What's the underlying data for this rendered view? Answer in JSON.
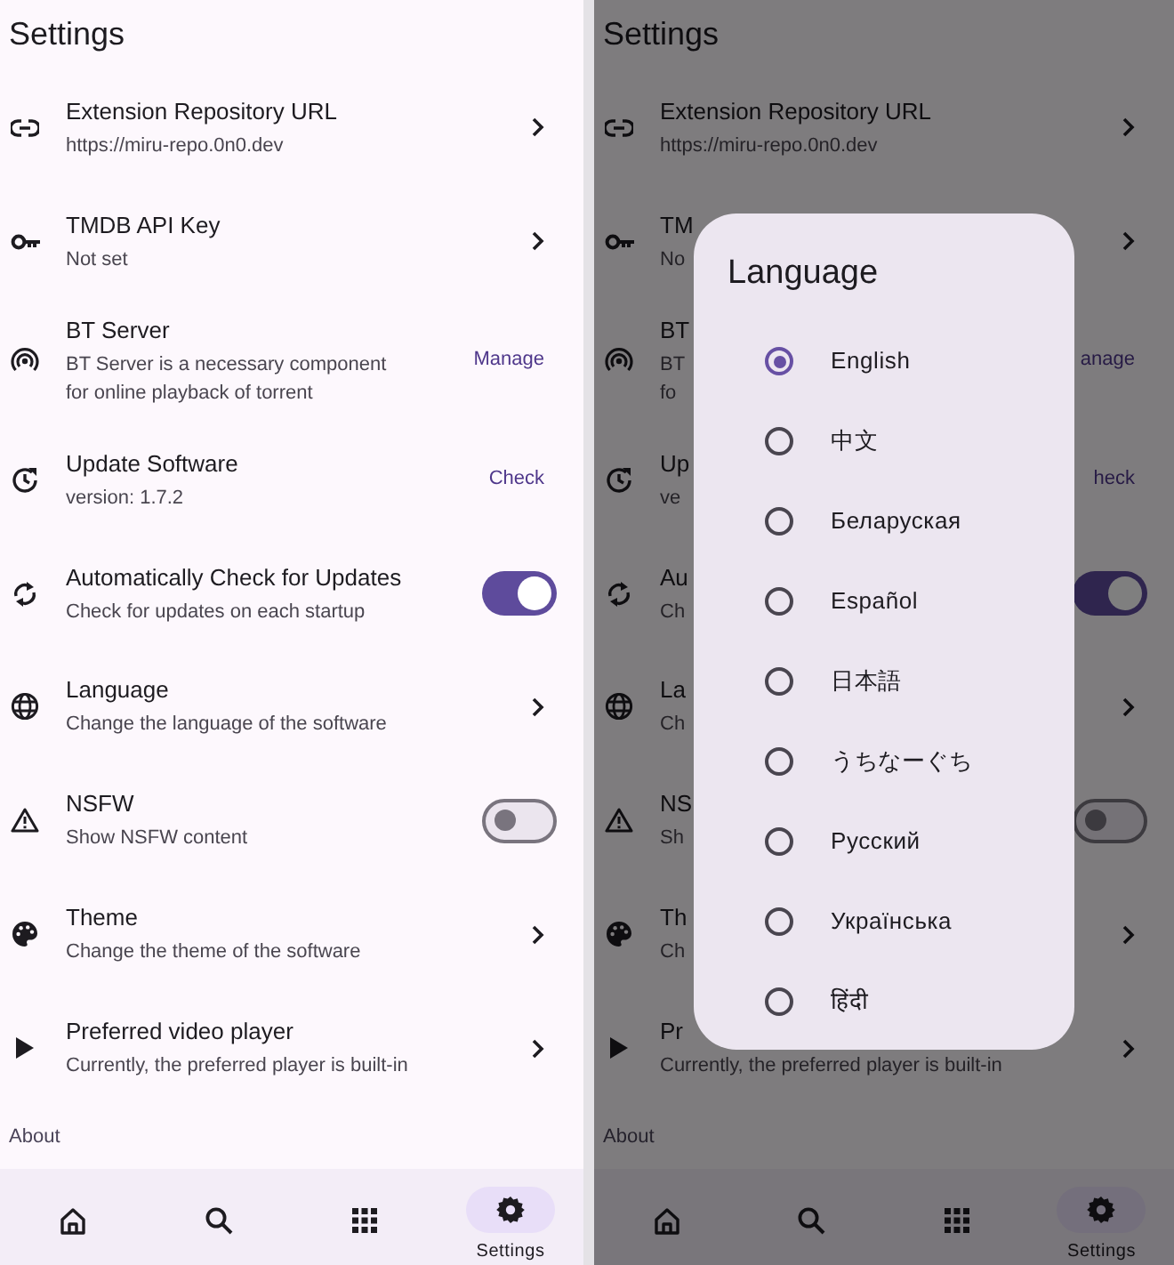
{
  "screens": [
    {
      "title": "Settings",
      "settings": [
        {
          "kind": "link",
          "title": "Extension Repository URL",
          "subtitle": "https://miru-repo.0n0.dev"
        },
        {
          "kind": "link",
          "title": "TMDB API Key",
          "subtitle": "Not set"
        },
        {
          "kind": "action",
          "title": "BT Server",
          "subtitle": "BT Server is a necessary component\nfor online playback of torrent",
          "action": "Manage"
        },
        {
          "kind": "action",
          "title": "Update Software",
          "subtitle": "version: 1.7.2",
          "action": "Check"
        },
        {
          "kind": "switch",
          "title": "Automatically Check for Updates",
          "subtitle": "Check for updates on each startup",
          "on": true
        },
        {
          "kind": "link",
          "title": "Language",
          "subtitle": "Change the language of the software"
        },
        {
          "kind": "switch",
          "title": "NSFW",
          "subtitle": "Show NSFW content",
          "on": false
        },
        {
          "kind": "link",
          "title": "Theme",
          "subtitle": "Change the theme of the software"
        },
        {
          "kind": "link",
          "title": "Preferred video player",
          "subtitle": "Currently, the preferred player is built-in"
        }
      ],
      "section": "About",
      "nav": [
        {
          "kind": "home",
          "selected": false
        },
        {
          "kind": "search",
          "selected": false
        },
        {
          "kind": "apps",
          "selected": false
        },
        {
          "kind": "settings",
          "label": "Settings",
          "selected": true
        }
      ]
    },
    {
      "title": "Settings",
      "settings": [
        {
          "kind": "link",
          "title": "Extension Repository URL",
          "subtitle": "https://miru-repo.0n0.dev"
        },
        {
          "kind": "link",
          "title": "TM",
          "subtitle": "No"
        },
        {
          "kind": "action",
          "title": "BT",
          "subtitle": "BT\nfo",
          "action": "anage"
        },
        {
          "kind": "action",
          "title": "Up",
          "subtitle": "ve",
          "action": "heck"
        },
        {
          "kind": "switch",
          "title": "Au",
          "subtitle": "Ch",
          "on": true
        },
        {
          "kind": "link",
          "title": "La",
          "subtitle": "Ch"
        },
        {
          "kind": "switch",
          "title": "NS",
          "subtitle": "Sh",
          "on": false
        },
        {
          "kind": "link",
          "title": "Th",
          "subtitle": "Ch"
        },
        {
          "kind": "link",
          "title": "Pr",
          "subtitle": "Currently, the preferred player is built-in"
        }
      ],
      "section": "About",
      "nav": [
        {
          "kind": "home",
          "selected": false
        },
        {
          "kind": "search",
          "selected": false
        },
        {
          "kind": "apps",
          "selected": false
        },
        {
          "kind": "settings",
          "label": "Settings",
          "selected": true
        }
      ],
      "dialog": {
        "title": "Language",
        "options": [
          {
            "label": "English",
            "selected": true
          },
          {
            "label": "中文",
            "selected": false
          },
          {
            "label": "Беларуская",
            "selected": false
          },
          {
            "label": "Español",
            "selected": false
          },
          {
            "label": "日本語",
            "selected": false
          },
          {
            "label": "うちなーぐち",
            "selected": false
          },
          {
            "label": "Русский",
            "selected": false
          },
          {
            "label": "Українська",
            "selected": false
          },
          {
            "label": "हिंदी",
            "selected": false
          }
        ]
      }
    }
  ]
}
